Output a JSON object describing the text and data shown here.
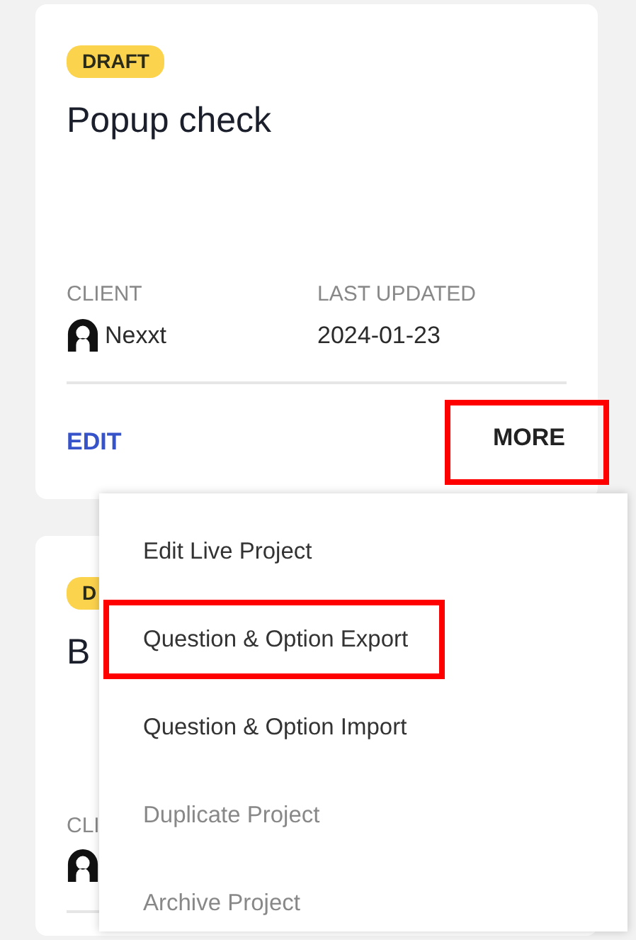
{
  "cards": [
    {
      "status": "DRAFT",
      "title": "Popup check",
      "client_label": "CLIENT",
      "client": "Nexxt",
      "updated_label": "LAST UPDATED",
      "updated": "2024-01-23",
      "edit": "EDIT",
      "more": {
        "label": "MORE",
        "highlighted": true
      }
    },
    {
      "status": "D",
      "title": "B",
      "client_label": "CLI"
    }
  ],
  "menu": {
    "items": [
      {
        "label": "Edit Live Project",
        "disabled": false,
        "highlighted": false
      },
      {
        "label": "Question & Option Export",
        "disabled": false,
        "highlighted": true
      },
      {
        "label": "Question & Option Import",
        "disabled": false,
        "highlighted": false
      },
      {
        "label": "Duplicate Project",
        "disabled": true,
        "highlighted": false
      },
      {
        "label": "Archive Project",
        "disabled": true,
        "highlighted": false
      }
    ]
  }
}
